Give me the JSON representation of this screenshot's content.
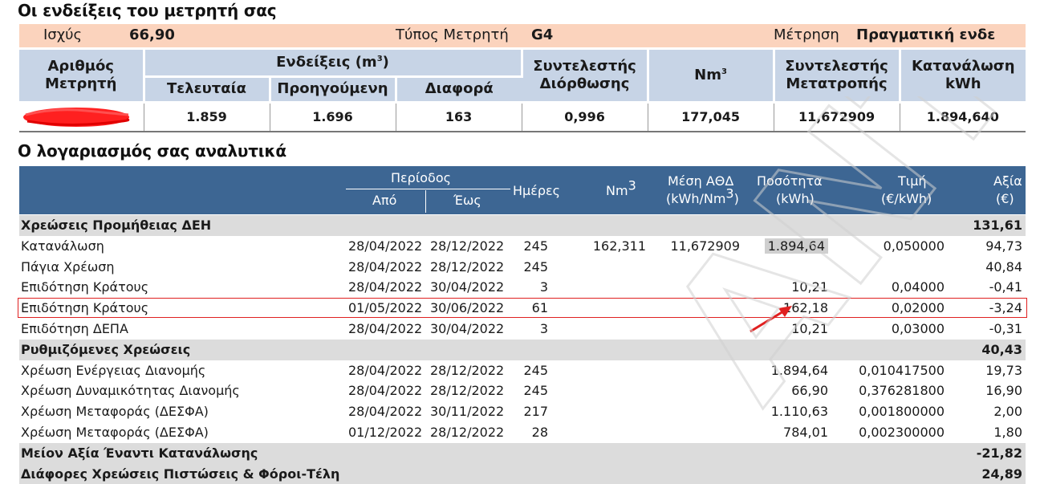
{
  "meter_section": {
    "title": "Οι ενδείξεις του μετρητή σας",
    "info": {
      "power_label": "Ισχύς",
      "power_value": "66,90",
      "type_label": "Τύπος Μετρητή",
      "type_value": "G4",
      "measure_label": "Μέτρηση",
      "measure_value": "Πραγματική ενδε"
    },
    "headers": {
      "meter_number": [
        "Αριθμός",
        "Μετρητή"
      ],
      "readings": "Ενδείξεις (m",
      "readings_sup": "3",
      "readings_close": ")",
      "last": "Τελευταία",
      "previous": "Προηγούμενη",
      "difference": "Διαφορά",
      "correction": [
        "Συντελεστής",
        "Διόρθωσης"
      ],
      "nm3": "Nm",
      "nm3_sup": "3",
      "conversion": [
        "Συντελεστής",
        "Μετατροπής"
      ],
      "consumption": [
        "Κατανάλωση",
        "kWh"
      ]
    },
    "row": {
      "last": "1.859",
      "previous": "1.696",
      "difference": "163",
      "correction": "0,996",
      "nm3": "177,045",
      "conversion": "11,672909",
      "consumption": "1.894,640"
    }
  },
  "bill_section": {
    "title": "Ο λογαριασμός σας αναλυτικά",
    "headers": {
      "period": "Περίοδος",
      "from": "Από",
      "to": "Έως",
      "days": "Ημέρες",
      "nm3": "Nm",
      "nm3_sup": "3",
      "ath": [
        "Μέση ΑΘΔ",
        "(kWh/Nm"
      ],
      "ath_sup": "3",
      "ath_close": ")",
      "qty": [
        "Ποσότητα",
        "(kWh)"
      ],
      "price": [
        "Τιμή",
        "(€/kWh)"
      ],
      "value": [
        "Αξία",
        "(€)"
      ]
    },
    "rows": [
      {
        "type": "section",
        "label": "Χρεώσεις Προμήθειας ΔΕΗ",
        "value": "131,61"
      },
      {
        "label": "Κατανάλωση",
        "from": "28/04/2022",
        "to": "28/12/2022",
        "days": "245",
        "nm3": "162,311",
        "ath": "11,672909",
        "qty": "1.894,64",
        "price": "0,050000",
        "value": "94,73"
      },
      {
        "label": "Πάγια Χρέωση",
        "from": "28/04/2022",
        "to": "28/12/2022",
        "days": "245",
        "value": "40,84"
      },
      {
        "label": "Επιδότηση Κράτους",
        "from": "28/04/2022",
        "to": "30/04/2022",
        "days": "3",
        "qty": "10,21",
        "price": "0,04000",
        "value": "-0,41"
      },
      {
        "label": "Επιδότηση Κράτους",
        "from": "01/05/2022",
        "to": "30/06/2022",
        "days": "61",
        "qty": "162,18",
        "price": "0,02000",
        "value": "-3,24"
      },
      {
        "label": "Επιδότηση ΔΕΠΑ",
        "from": "28/04/2022",
        "to": "30/04/2022",
        "days": "3",
        "qty": "10,21",
        "price": "0,03000",
        "value": "-0,31"
      },
      {
        "type": "section",
        "label": "Ρυθμιζόμενες Χρεώσεις",
        "value": "40,43"
      },
      {
        "label": "Χρέωση Ενέργειας Διανομής",
        "from": "28/04/2022",
        "to": "28/12/2022",
        "days": "245",
        "qty": "1.894,64",
        "price": "0,010417500",
        "value": "19,73"
      },
      {
        "label": "Χρέωση Δυναμικότητας Διανομής",
        "from": "28/04/2022",
        "to": "28/12/2022",
        "days": "245",
        "qty": "66,90",
        "price": "0,376281800",
        "value": "16,90"
      },
      {
        "label": "Χρέωση Μεταφοράς (ΔΕΣΦΑ)",
        "from": "28/04/2022",
        "to": "30/11/2022",
        "days": "217",
        "qty": "1.110,63",
        "price": "0,001800000",
        "value": "2,00"
      },
      {
        "label": "Χρέωση Μεταφοράς (ΔΕΣΦΑ)",
        "from": "01/12/2022",
        "to": "28/12/2022",
        "days": "28",
        "qty": "784,01",
        "price": "0,002300000",
        "value": "1,80"
      },
      {
        "type": "section",
        "label": "Μείον Αξία Έναντι Κατανάλωσης",
        "value": "-21,82"
      },
      {
        "type": "section",
        "label": "Διάφορες Χρεώσεις Πιστώσεις & Φόροι-Τέλη",
        "value": "24,89"
      }
    ]
  },
  "watermark_text": "ΑΝΤΙΓΡΑΦΟ",
  "colors": {
    "info_bar": "#fbd3bd",
    "meter_header": "#c7d4e6",
    "bill_header": "#3d6693",
    "section_row": "#dcdcdc",
    "highlight": "#e02020",
    "watermark": "#d0d0d0"
  }
}
